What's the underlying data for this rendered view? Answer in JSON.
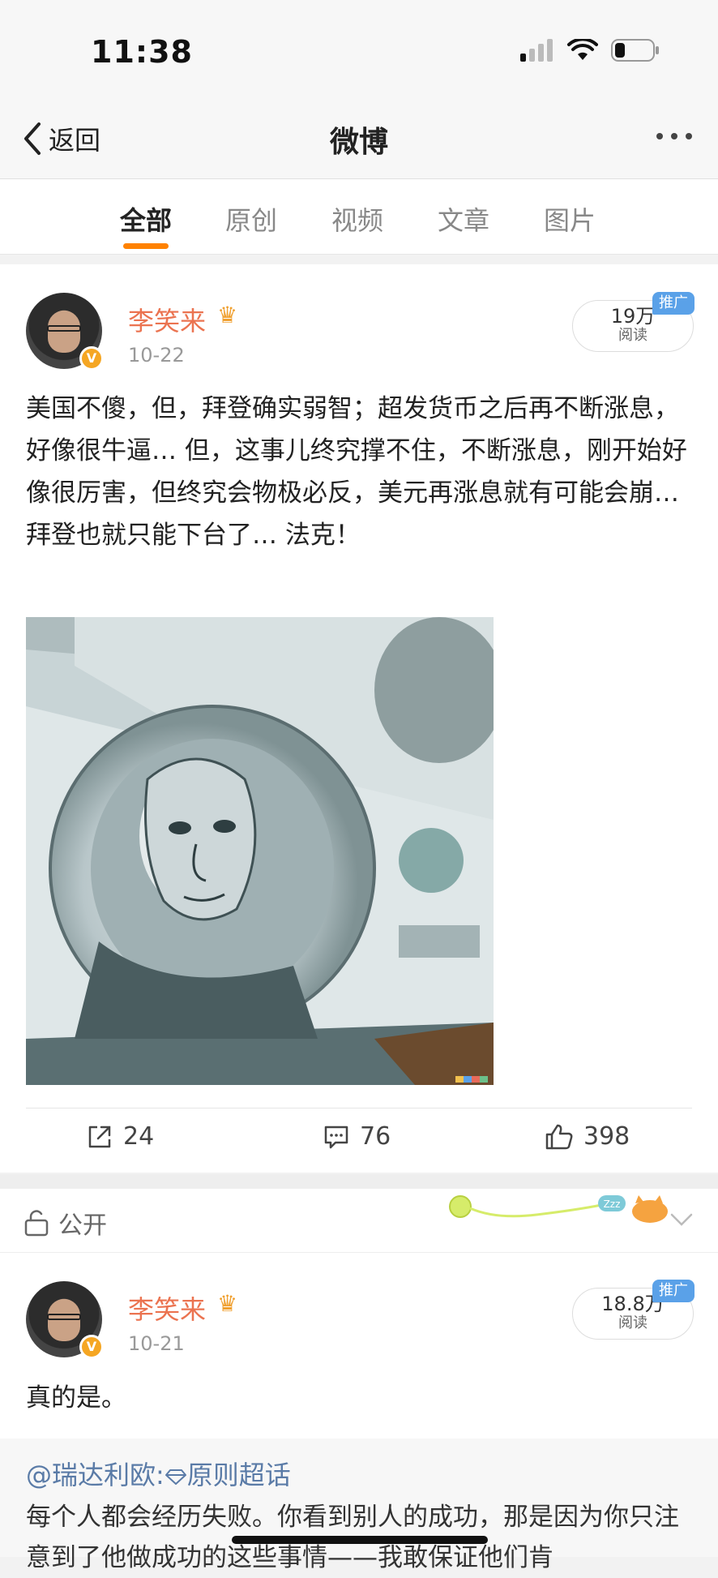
{
  "status": {
    "time": "11:38"
  },
  "nav": {
    "back_label": "返回",
    "title": "微博"
  },
  "tabs": [
    {
      "label": "全部",
      "active": true
    },
    {
      "label": "原创"
    },
    {
      "label": "视频"
    },
    {
      "label": "文章"
    },
    {
      "label": "图片"
    }
  ],
  "post1": {
    "author": "李笑来",
    "date": "10-22",
    "reads": "19万",
    "reads_label": "阅读",
    "promo_badge": "推广",
    "verified_badge": "V",
    "text": "美国不傻，但，拜登确实弱智；超发货币之后再不断涨息，好像很牛逼… 但，这事儿终究撑不住，不断涨息，刚开始好像很厉害，但终究会物极必反，美元再涨息就有可能会崩… 拜登也就只能下台了… 法克！",
    "image_icon": "hundred-dollar-bill-photo",
    "reposts": "24",
    "comments": "76",
    "likes": "398"
  },
  "privacy": {
    "label": "公开",
    "sleep_badge": "Zzz"
  },
  "post2": {
    "author": "李笑来",
    "date": "10-21",
    "reads": "18.8万",
    "reads_label": "阅读",
    "promo_badge": "推广",
    "verified_badge": "V",
    "text": "真的是。",
    "repost": {
      "source_user": "@瑞达利欧",
      "colon": ":",
      "topic": "原则超话",
      "text": "每个人都会经历失败。你看到别人的成功，那是因为你只注意到了他做成功的这些事情——我敢保证他们肯"
    }
  },
  "colors": {
    "accent_orange": "#ff8200",
    "username": "#eb7350",
    "link_blue": "#5a7ba7",
    "promo_blue": "#5aa1e8"
  }
}
